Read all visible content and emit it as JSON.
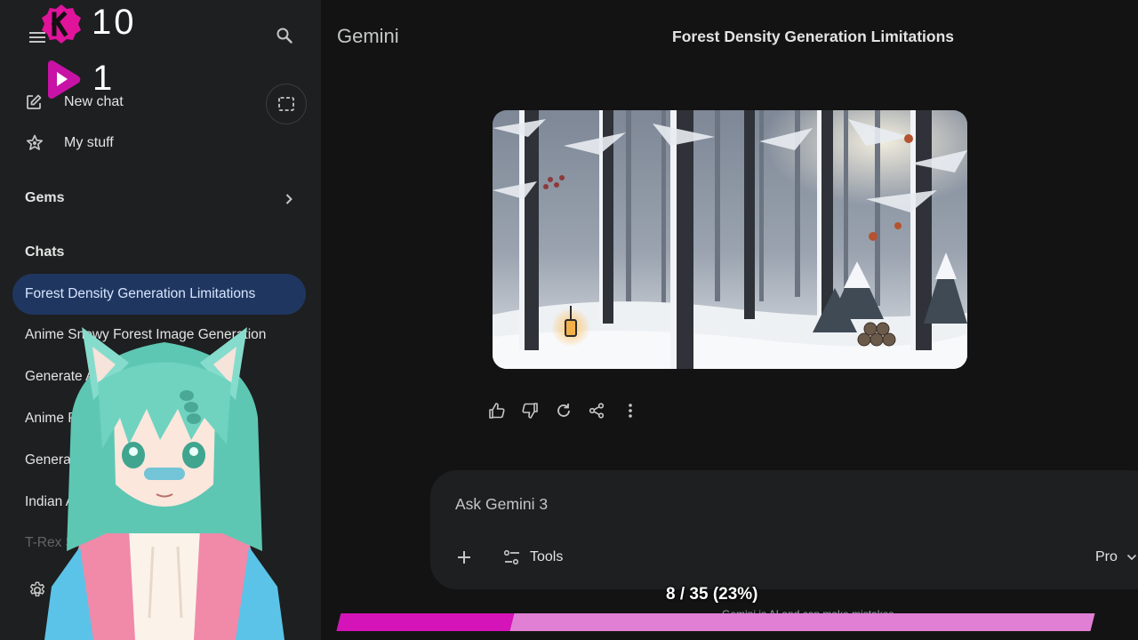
{
  "app": {
    "brand": "Gemini"
  },
  "conversation": {
    "title": "Forest Density Generation Limitations"
  },
  "sidebar": {
    "new_chat": "New chat",
    "my_stuff": "My stuff",
    "gems": "Gems",
    "chats_heading": "Chats",
    "chats": [
      {
        "label": "Forest Density Generation Limitations",
        "active": true
      },
      {
        "label": "Anime Snowy Forest Image Generation"
      },
      {
        "label": "Generate Anime Art Artwork w..."
      },
      {
        "label": "Anime Pattern Art Challe..."
      },
      {
        "label": "Generate Anime Art Highsc..."
      },
      {
        "label": "Indian Anime Art Patterns"
      },
      {
        "label": "T-Rex Sword Anime Cosplay"
      }
    ]
  },
  "overlay": {
    "k_count": "10",
    "play_count": "1"
  },
  "composer": {
    "placeholder": "Ask Gemini 3",
    "tools": "Tools",
    "model": "Pro"
  },
  "disclaimer": "Gemini is AI and can make mistakes.",
  "progress": {
    "label": "8 / 35 (23%)",
    "current": 8,
    "total": 35,
    "fraction": 0.23
  },
  "icons": {
    "menu": "menu-icon",
    "search": "search-icon",
    "new_chat": "edit-icon",
    "my_stuff": "star-icon",
    "temp_chat": "dashed-square-icon",
    "chevron": "chevron-right-icon",
    "settings": "gear-icon",
    "thumb_up": "thumb-up-icon",
    "thumb_down": "thumb-down-icon",
    "regenerate": "refresh-icon",
    "share": "share-icon",
    "more": "more-vert-icon",
    "add": "plus-icon",
    "tools": "tune-icon",
    "model_chevron": "chevron-down-icon"
  },
  "colors": {
    "active_chat": "#1f3760",
    "progress_fill": "#d413b8",
    "progress_track": "#e07fd4",
    "overlay_accent": "#e0139b"
  }
}
